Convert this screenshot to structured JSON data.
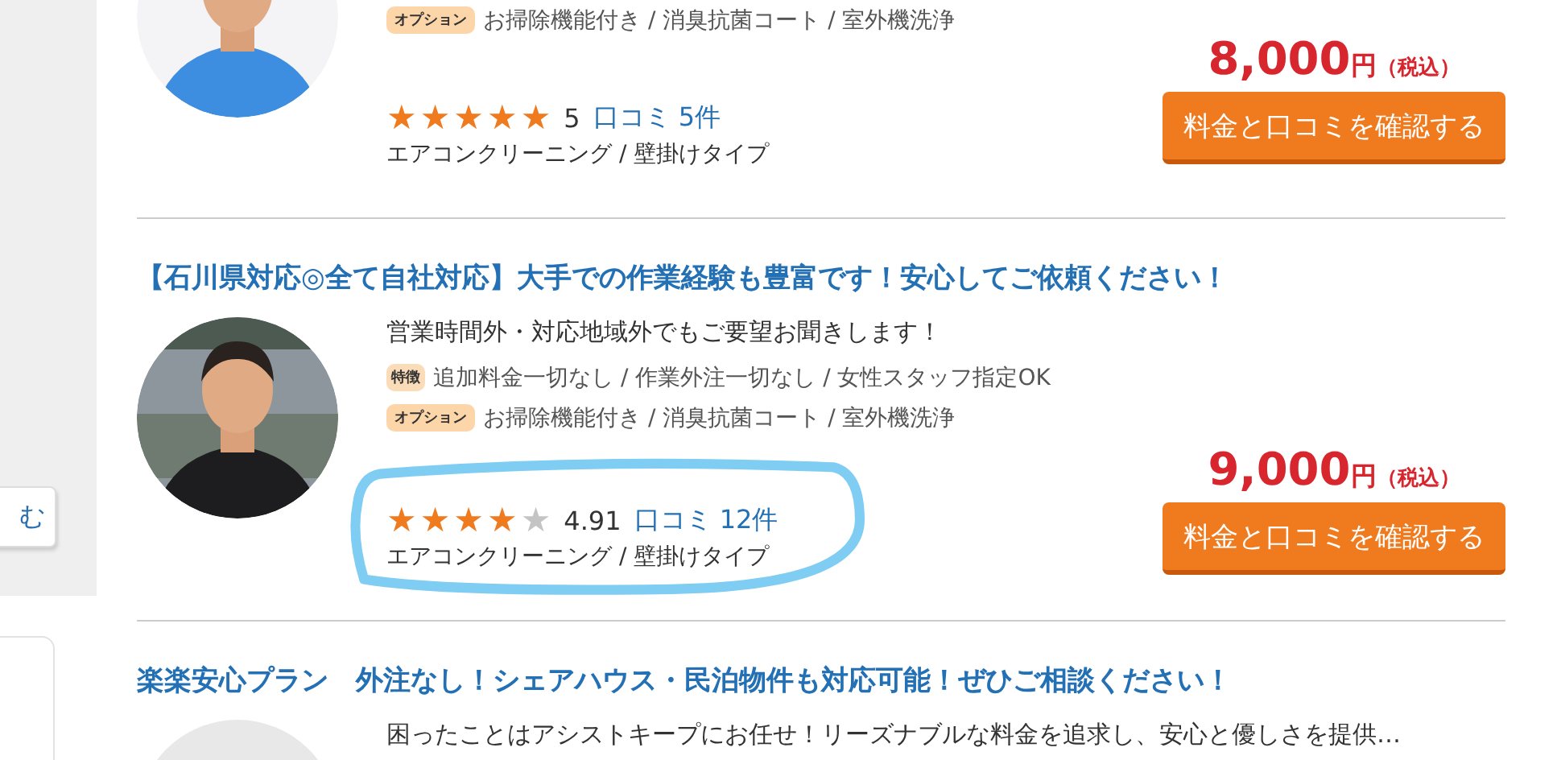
{
  "sidebar": {
    "button_label": "む"
  },
  "listings": [
    {
      "avatar": {
        "kind": "picture"
      },
      "tags": [
        {
          "kind": "option",
          "label": "オプション",
          "text": "お掃除機能付き / 消臭抗菌コート / 室外機洗浄"
        }
      ],
      "rating": {
        "stars": 5,
        "score": "5",
        "reviews": "口コミ 5件",
        "highlighted": false
      },
      "category": "エアコンクリーニング / 壁掛けタイプ",
      "price": {
        "amount": "8,000",
        "unit": "円",
        "tax": "（税込）"
      },
      "button": "料金と口コミを確認する"
    },
    {
      "title": "【石川県対応◎全て自社対応】大手での作業経験も豊富です！安心してご依頼ください！",
      "avatar": {
        "kind": "picture"
      },
      "description": "営業時間外・対応地域外でもご要望お聞きします！",
      "tags": [
        {
          "kind": "feature",
          "label": "特徴",
          "text": "追加料金一切なし / 作業外注一切なし / 女性スタッフ指定OK"
        },
        {
          "kind": "option",
          "label": "オプション",
          "text": "お掃除機能付き / 消臭抗菌コート / 室外機洗浄"
        }
      ],
      "rating": {
        "stars": 4,
        "score": "4.91",
        "reviews": "口コミ 12件",
        "highlighted": true
      },
      "category": "エアコンクリーニング / 壁掛けタイプ",
      "price": {
        "amount": "9,000",
        "unit": "円",
        "tax": "（税込）"
      },
      "button": "料金と口コミを確認する"
    },
    {
      "title": "楽楽安心プラン　外注なし！シェアハウス・民泊物件も対応可能！ぜひご相談ください！",
      "avatar": {
        "kind": "placeholder"
      },
      "description": "困ったことはアシストキープにお任せ！リーズナブルな料金を追求し、安心と優しさを提供…"
    }
  ]
}
